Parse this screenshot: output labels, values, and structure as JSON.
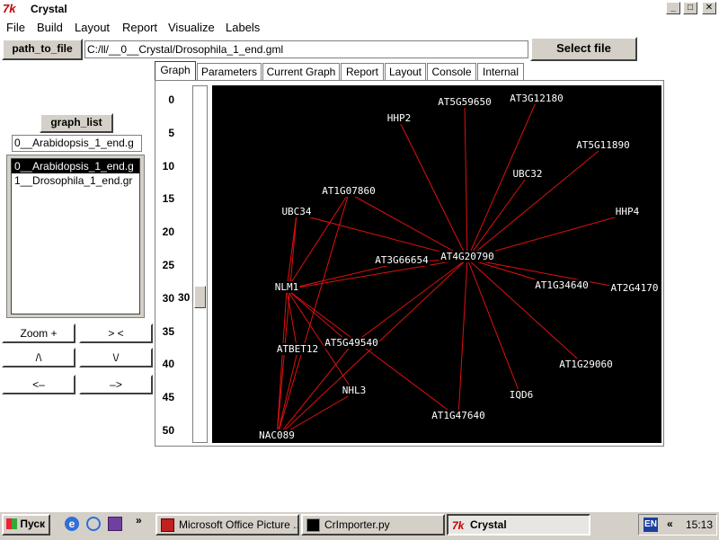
{
  "window": {
    "logo": "7k",
    "title": "Crystal",
    "controls": {
      "minimize": "_",
      "maximize": "□",
      "close": "✕"
    }
  },
  "menu": [
    "File",
    "Build",
    "Layout",
    "Report",
    "Visualize",
    "Labels"
  ],
  "toolbar": {
    "path_button": "path_to_file",
    "path_value": "C:/ll/__0__Crystal/Drosophila_1_end.gml",
    "select_button": "Select file"
  },
  "left_panel": {
    "graph_list_button": "graph_list",
    "graph_list_entry": "0__Arabidopsis_1_end.g",
    "list_items": [
      "0__Arabidopsis_1_end.g",
      "1__Drosophila_1_end.gr"
    ],
    "zoom_in": "Zoom +",
    "shrink": "> <",
    "up": "/\\",
    "down": "\\/",
    "left": "<–",
    "right": "–>"
  },
  "tabs": [
    "Graph",
    "Parameters",
    "Current Graph",
    "Report",
    "Layout",
    "Console",
    "Internal"
  ],
  "active_tab": "Graph",
  "ruler": {
    "ticks": [
      "0",
      "5",
      "10",
      "15",
      "20",
      "25",
      "30",
      "35",
      "40",
      "45",
      "50"
    ],
    "current": "30",
    "position": 0.6
  },
  "graph": {
    "background": "#000000",
    "edge_color": "#e01010",
    "label_color": "#ffffff",
    "nodes": [
      {
        "id": "AT4G20790"
      },
      {
        "id": "NLM1"
      },
      {
        "id": "NAC089"
      },
      {
        "id": "HHP2"
      },
      {
        "id": "AT5G59650"
      },
      {
        "id": "AT3G12180"
      },
      {
        "id": "AT5G11890"
      },
      {
        "id": "UBC32"
      },
      {
        "id": "HHP4"
      },
      {
        "id": "AT1G07860"
      },
      {
        "id": "UBC34"
      },
      {
        "id": "AT3G66654"
      },
      {
        "id": "AT1G34640"
      },
      {
        "id": "AT2G4170"
      },
      {
        "id": "AT5G49540"
      },
      {
        "id": "ATBET12"
      },
      {
        "id": "AT1G29060"
      },
      {
        "id": "NHL3"
      },
      {
        "id": "IQD6"
      },
      {
        "id": "AT1G47640"
      }
    ],
    "edges": [
      [
        "AT4G20790",
        "HHP2"
      ],
      [
        "AT4G20790",
        "AT5G59650"
      ],
      [
        "AT4G20790",
        "AT3G12180"
      ],
      [
        "AT4G20790",
        "AT5G11890"
      ],
      [
        "AT4G20790",
        "UBC32"
      ],
      [
        "AT4G20790",
        "HHP4"
      ],
      [
        "AT4G20790",
        "AT1G07860"
      ],
      [
        "AT4G20790",
        "UBC34"
      ],
      [
        "AT4G20790",
        "AT3G66654"
      ],
      [
        "AT4G20790",
        "AT1G34640"
      ],
      [
        "AT4G20790",
        "AT2G4170"
      ],
      [
        "AT4G20790",
        "AT1G29060"
      ],
      [
        "AT4G20790",
        "IQD6"
      ],
      [
        "AT4G20790",
        "AT1G47640"
      ],
      [
        "AT4G20790",
        "NLM1"
      ],
      [
        "AT4G20790",
        "AT5G49540"
      ],
      [
        "AT4G20790",
        "NAC089"
      ],
      [
        "NLM1",
        "AT1G07860"
      ],
      [
        "NLM1",
        "UBC34"
      ],
      [
        "NLM1",
        "AT3G66654"
      ],
      [
        "NLM1",
        "ATBET12"
      ],
      [
        "NLM1",
        "AT5G49540"
      ],
      [
        "NLM1",
        "NHL3"
      ],
      [
        "NLM1",
        "NAC089"
      ],
      [
        "NLM1",
        "AT1G47640"
      ],
      [
        "NAC089",
        "UBC34"
      ],
      [
        "NAC089",
        "AT1G07860"
      ],
      [
        "NAC089",
        "ATBET12"
      ],
      [
        "NAC089",
        "NHL3"
      ],
      [
        "NAC089",
        "AT5G49540"
      ]
    ]
  },
  "taskbar": {
    "start": "Пуск",
    "quicklaunch_more": "»",
    "tasks": [
      {
        "label": "Microsoft Office Picture ...",
        "icon": "picture-manager-icon"
      },
      {
        "label": "CrImporter.py",
        "icon": "console-icon"
      },
      {
        "label": "Crystal",
        "icon": "tk-icon",
        "active": true
      }
    ],
    "tray_expand": "«",
    "language": "EN",
    "clock": "15:13"
  }
}
